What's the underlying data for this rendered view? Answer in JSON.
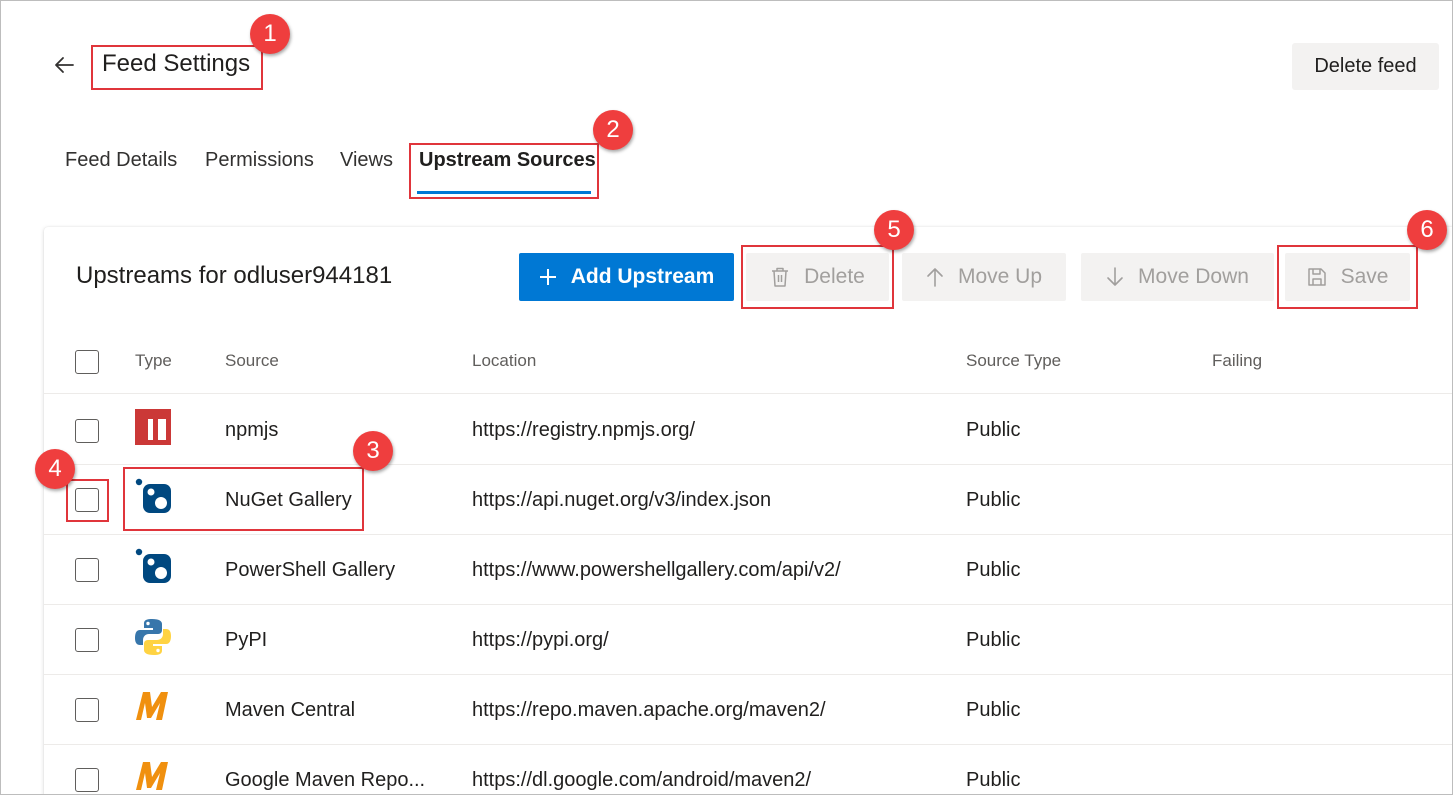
{
  "header": {
    "title": "Feed Settings",
    "delete_feed_label": "Delete feed"
  },
  "tabs": [
    {
      "label": "Feed Details"
    },
    {
      "label": "Permissions"
    },
    {
      "label": "Views"
    },
    {
      "label": "Upstream Sources",
      "active": true
    }
  ],
  "card": {
    "title": "Upstreams for odluser944181"
  },
  "toolbar": {
    "add_label": "Add Upstream",
    "delete_label": "Delete",
    "move_up_label": "Move Up",
    "move_down_label": "Move Down",
    "save_label": "Save"
  },
  "table": {
    "columns": [
      "Type",
      "Source",
      "Location",
      "Source Type",
      "Failing"
    ],
    "rows": [
      {
        "icon": "npm-icon",
        "source": "npmjs",
        "location": "https://registry.npmjs.org/",
        "source_type": "Public"
      },
      {
        "icon": "nuget-icon",
        "source": "NuGet Gallery",
        "location": "https://api.nuget.org/v3/index.json",
        "source_type": "Public"
      },
      {
        "icon": "nuget-icon",
        "source": "PowerShell Gallery",
        "location": "https://www.powershellgallery.com/api/v2/",
        "source_type": "Public"
      },
      {
        "icon": "python-icon",
        "source": "PyPI",
        "location": "https://pypi.org/",
        "source_type": "Public"
      },
      {
        "icon": "maven-icon",
        "source": "Maven Central",
        "location": "https://repo.maven.apache.org/maven2/",
        "source_type": "Public"
      },
      {
        "icon": "maven-icon",
        "source": "Google Maven Repo...",
        "location": "https://dl.google.com/android/maven2/",
        "source_type": "Public"
      }
    ]
  },
  "annotations": [
    "1",
    "2",
    "3",
    "4",
    "5",
    "6"
  ],
  "colors": {
    "accent": "#0078d4",
    "annotation_red": "#ef3e3e",
    "npm_red": "#cb3837",
    "nuget_blue": "#004880",
    "maven_orange": "#f0900f"
  }
}
